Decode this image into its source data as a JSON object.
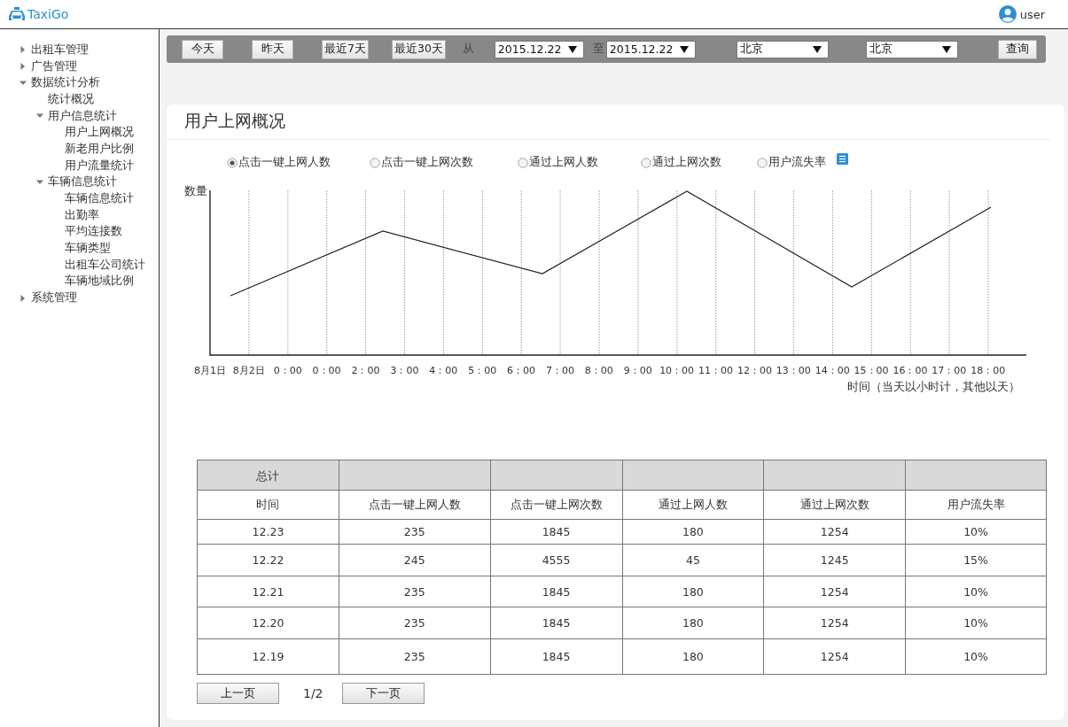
{
  "header": {
    "brand": "TaxiGo",
    "user": "user"
  },
  "nav": {
    "items": [
      {
        "label": "出租车管理",
        "expanded": false
      },
      {
        "label": "广告管理",
        "expanded": false
      },
      {
        "label": "数据统计分析",
        "expanded": true,
        "children": [
          {
            "label": "统计概况"
          },
          {
            "label": "用户信息统计",
            "expanded": true,
            "children": [
              {
                "label": "用户上网概况"
              },
              {
                "label": "新老用户比例"
              },
              {
                "label": "用户流量统计"
              }
            ]
          },
          {
            "label": "车辆信息统计",
            "expanded": true,
            "children": [
              {
                "label": "车辆信息统计"
              },
              {
                "label": "出勤率"
              },
              {
                "label": "平均连接数"
              },
              {
                "label": "车辆类型"
              },
              {
                "label": "出租车公司统计"
              },
              {
                "label": "车辆地域比例"
              }
            ]
          }
        ]
      },
      {
        "label": "系统管理",
        "expanded": false
      }
    ]
  },
  "filters": {
    "quick_buttons": [
      "今天",
      "昨天",
      "最近7天",
      "最近30天"
    ],
    "from_label": "从",
    "from_date": "2015.12.22",
    "to_label": "至",
    "to_date": "2015.12.22",
    "city_1": "北京",
    "city_2": "北京",
    "query_button": "查询"
  },
  "panel": {
    "title": "用户上网概况",
    "options": [
      {
        "label": "点击一键上网人数",
        "selected": true
      },
      {
        "label": "点击一键上网次数",
        "selected": false
      },
      {
        "label": "通过上网人数",
        "selected": false
      },
      {
        "label": "通过上网次数",
        "selected": false
      },
      {
        "label": "用户流失率",
        "selected": false
      }
    ],
    "chart": {
      "ylabel": "数量",
      "xlabel": "时间（当天以小时计，其他以天）",
      "x_labels": [
        "8月1日",
        "8月2日",
        "0：00",
        "0：00",
        "2：00",
        "3：00",
        "4：00",
        "5：00",
        "6：00",
        "7：00",
        "8：00",
        "9：00",
        "10：00",
        "11：00",
        "12：00",
        "13：00",
        "14：00",
        "15：00",
        "16：00",
        "17：00",
        "18：00"
      ]
    },
    "table": {
      "total_label": "总计",
      "columns": [
        "时间",
        "点击一键上网人数",
        "点击一键上网次数",
        "通过上网人数",
        "通过上网次数",
        "用户流失率"
      ],
      "rows": [
        [
          "12.23",
          "235",
          "1845",
          "180",
          "1254",
          "10%"
        ],
        [
          "12.22",
          "245",
          "4555",
          "45",
          "1245",
          "15%"
        ],
        [
          "12.21",
          "235",
          "1845",
          "180",
          "1254",
          "10%"
        ],
        [
          "12.20",
          "235",
          "1845",
          "180",
          "1254",
          "10%"
        ],
        [
          "12.19",
          "235",
          "1845",
          "180",
          "1254",
          "10%"
        ]
      ]
    },
    "pager": {
      "prev": "上一页",
      "page": "1/2",
      "next": "下一页"
    }
  }
}
